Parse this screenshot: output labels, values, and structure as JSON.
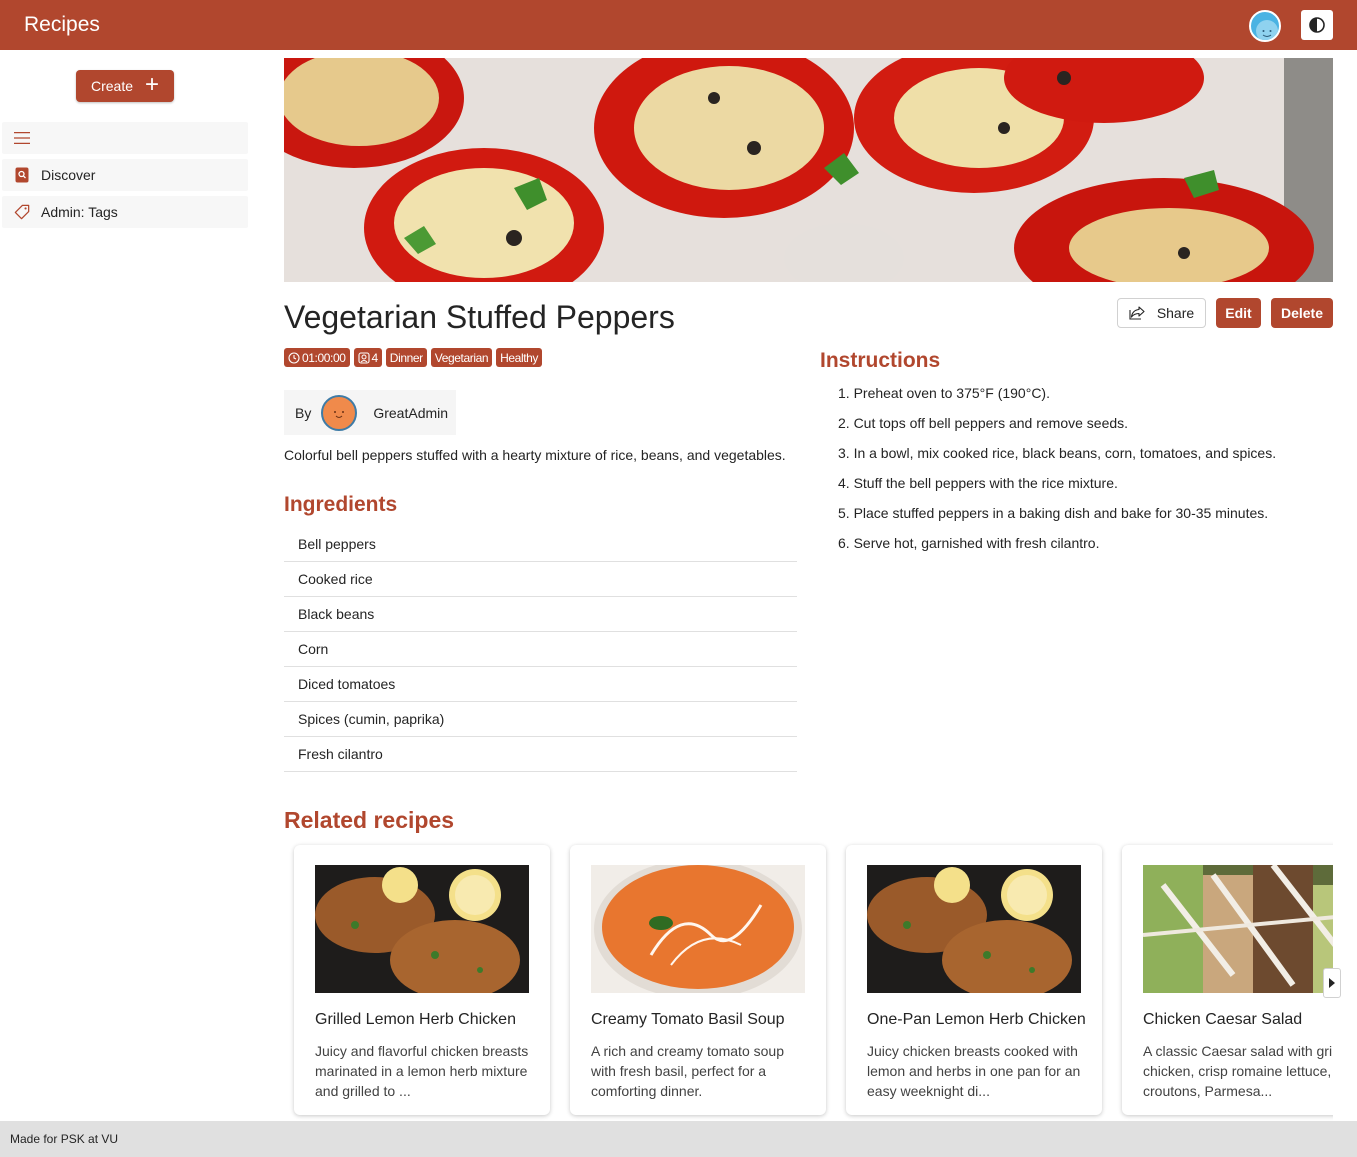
{
  "header": {
    "app_title": "Recipes",
    "accent_color": "#b1472e"
  },
  "sidebar": {
    "create_label": "Create",
    "items": [
      {
        "label": "",
        "icon": "hamburger-icon"
      },
      {
        "label": "Discover",
        "icon": "book-search-icon"
      },
      {
        "label": "Admin: Tags",
        "icon": "tag-icon"
      }
    ]
  },
  "recipe": {
    "title": "Vegetarian Stuffed Peppers",
    "duration": "01:00:00",
    "servings": "4",
    "tags": [
      "Dinner",
      "Vegetarian",
      "Healthy"
    ],
    "author_prefix": "By",
    "author_name": "GreatAdmin",
    "description": "Colorful bell peppers stuffed with a hearty mixture of rice, beans, and vegetables."
  },
  "actions": {
    "share_label": "Share",
    "edit_label": "Edit",
    "delete_label": "Delete"
  },
  "ingredients": {
    "heading": "Ingredients",
    "items": [
      "Bell peppers",
      "Cooked rice",
      "Black beans",
      "Corn",
      "Diced tomatoes",
      "Spices (cumin, paprika)",
      "Fresh cilantro"
    ]
  },
  "instructions": {
    "heading": "Instructions",
    "steps": [
      "1. Preheat oven to 375°F (190°C).",
      "2. Cut tops off bell peppers and remove seeds.",
      "3. In a bowl, mix cooked rice, black beans, corn, tomatoes, and spices.",
      "4. Stuff the bell peppers with the rice mixture.",
      "5. Place stuffed peppers in a baking dish and bake for 30-35 minutes.",
      "6. Serve hot, garnished with fresh cilantro."
    ]
  },
  "related": {
    "heading": "Related recipes",
    "cards": [
      {
        "title": "Grilled Lemon Herb Chicken",
        "description": "Juicy and flavorful chicken breasts marinated in a lemon herb mixture and grilled to ..."
      },
      {
        "title": "Creamy Tomato Basil Soup",
        "description": "A rich and creamy tomato soup with fresh basil, perfect for a comforting dinner."
      },
      {
        "title": "One-Pan Lemon Herb Chicken",
        "description": "Juicy chicken breasts cooked with lemon and herbs in one pan for an easy weeknight di..."
      },
      {
        "title": "Chicken Caesar Salad",
        "description": "A classic Caesar salad with grilled chicken, crisp romaine lettuce, croutons, Parmesa..."
      }
    ]
  },
  "footer": {
    "text": "Made for PSK at VU"
  }
}
